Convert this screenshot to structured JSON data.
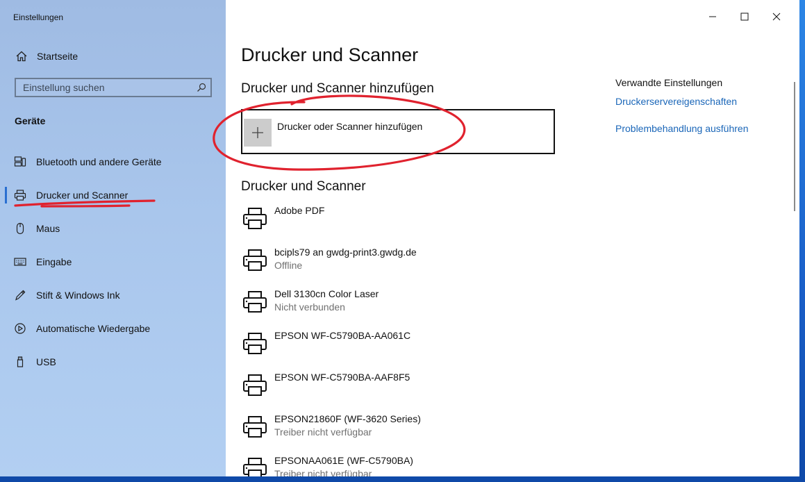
{
  "window": {
    "title": "Einstellungen"
  },
  "sidebar": {
    "home_label": "Startseite",
    "search_placeholder": "Einstellung suchen",
    "section_label": "Geräte",
    "items": [
      {
        "label": "Bluetooth und andere Geräte",
        "icon": "bluetooth-devices-icon"
      },
      {
        "label": "Drucker und Scanner",
        "icon": "printer-icon",
        "selected": true
      },
      {
        "label": "Maus",
        "icon": "mouse-icon"
      },
      {
        "label": "Eingabe",
        "icon": "keyboard-icon"
      },
      {
        "label": "Stift & Windows Ink",
        "icon": "pen-icon"
      },
      {
        "label": "Automatische Wiedergabe",
        "icon": "autoplay-icon"
      },
      {
        "label": "USB",
        "icon": "usb-icon"
      }
    ]
  },
  "main": {
    "page_title": "Drucker und Scanner",
    "add_section_title": "Drucker und Scanner hinzufügen",
    "add_button_label": "Drucker oder Scanner hinzufügen",
    "list_title": "Drucker und Scanner",
    "printers": [
      {
        "name": "Adobe PDF",
        "status": ""
      },
      {
        "name": "bcipls79 an gwdg-print3.gwdg.de",
        "status": "Offline"
      },
      {
        "name": "Dell 3130cn Color Laser",
        "status": "Nicht verbunden"
      },
      {
        "name": "EPSON WF-C5790BA-AA061C",
        "status": ""
      },
      {
        "name": "EPSON WF-C5790BA-AAF8F5",
        "status": ""
      },
      {
        "name": "EPSON21860F (WF-3620 Series)",
        "status": "Treiber nicht verfügbar"
      },
      {
        "name": "EPSONAA061E (WF-C5790BA)",
        "status": "Treiber nicht verfügbar"
      }
    ]
  },
  "related": {
    "title": "Verwandte Einstellungen",
    "links": [
      "Druckerservereigenschaften",
      "Problembehandlung ausführen"
    ]
  },
  "colors": {
    "accent": "#2a6fd1",
    "link": "#1a66b8",
    "annotation": "#e0222e"
  }
}
